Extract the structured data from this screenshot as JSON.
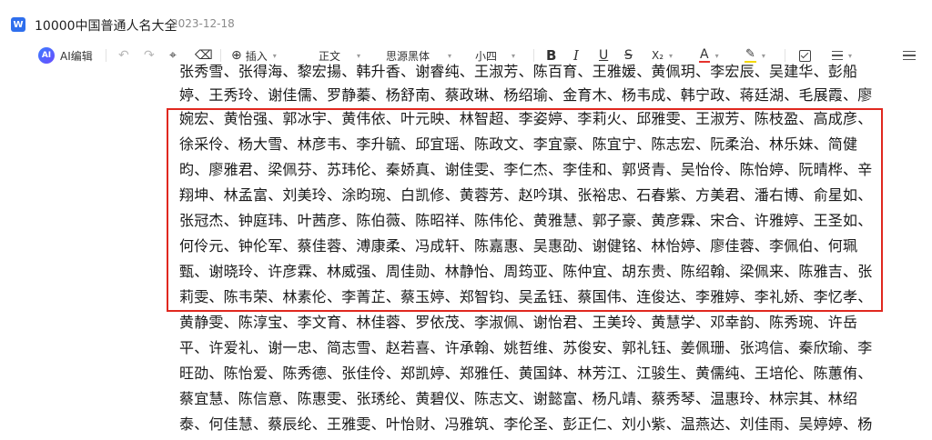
{
  "header": {
    "doc_icon": "W",
    "title": "10000中国普通人名大全",
    "date": "2023-12-18"
  },
  "toolbar": {
    "ai_badge": "AI",
    "ai_label": "AI编辑",
    "undo_icon": "↶",
    "redo_icon": "↷",
    "format_painter_icon": "⌖",
    "eraser_icon": "⌫",
    "insert_icon": "⊕",
    "insert_label": "插入",
    "style_label": "正文",
    "font_label": "思源黑体",
    "size_label": "小四",
    "bold": "B",
    "italic": "I",
    "underline": "U",
    "strike": "S",
    "subscript": "X₂",
    "font_color": "A",
    "highlight": "✎",
    "caret": "▾",
    "colors": {
      "font_color": "#e5322d",
      "highlight": "#f5d90a"
    }
  },
  "document": {
    "lines": [
      "张秀雪、张得海、黎宏揚、韩升香、谢睿纯、王淑芳、陈百育、王雅媛、黄佩玥、李宏辰、吴建华、彭船",
      "婷、王秀玲、谢佳儒、罗静蓁、杨舒南、蔡政琳、杨绍瑜、金育木、杨韦成、韩宁政、蒋廷湖、毛展霞、廖",
      "婉宏、黄怡强、郭冰宇、黄伟依、叶元映、林智超、李姿婷、李莉火、邱雅雯、王淑芳、陈枝盈、高成彦、",
      "徐采伶、杨大雪、林彦韦、李升毓、邱宜瑶、陈政文、李宜豪、陈宜宁、陈志宏、阮柔治、林乐妹、简健",
      "昀、廖雅君、梁佩芬、苏玮伦、秦娇真、谢佳雯、李仁杰、李佳和、郭贤青、吴怡伶、陈怡婷、阮晴桦、辛",
      "翔坤、林孟富、刘美玲、涂昀琬、白凯修、黄蓉芳、赵吟琪、张裕忠、石春紫、方美君、潘右博、俞星如、",
      "张冠杰、钟庭玮、叶茜彦、陈伯薇、陈昭祥、陈伟伦、黄雅慧、郭子豪、黄彦霖、宋合、许雅婷、王圣如、",
      "何伶元、钟伦军、蔡佳蓉、溥康柔、冯成轩、陈嘉惠、吴惠劭、谢健铭、林怡婷、廖佳蓉、李佩伯、何珮",
      "甄、谢晓玲、许彦霖、林威强、周佳勋、林静怡、周筠亚、陈仲宜、胡东贵、陈绍翰、梁佩来、陈雅吉、张",
      "莉雯、陈韦荣、林素伦、李菁芷、蔡玉婷、郑智钧、吴孟钰、蔡国伟、连俊达、李雅婷、李礼娇、李忆孝、",
      "黄静雯、陈淳宝、李文育、林佳蓉、罗依茂、李淑佩、谢怡君、王美玲、黄慧学、邓幸韵、陈秀琬、许岳",
      "平、许爱礼、谢一忠、简志雪、赵若喜、许承翰、姚哲维、苏俊安、郭礼钰、姜佩珊、张鸿信、秦欣瑜、李",
      "旺劭、陈怡爱、陈秀德、张佳伶、郑凯婷、郑雅任、黄国鉢、林芳江、江骏生、黄儒纯、王培伦、陈蕙侑、",
      "蔡宜慧、陈信意、陈惠雯、张琇纶、黄碧仪、陈志文、谢懿富、杨凡靖、蔡秀琴、温惠玲、林宗其、林绍",
      "泰、何佳慧、蔡辰纶、王雅雯、叶怡财、冯雅筑、李伦圣、彭正仁、刘小紫、温燕达、刘佳雨、吴婷婷、杨"
    ]
  }
}
